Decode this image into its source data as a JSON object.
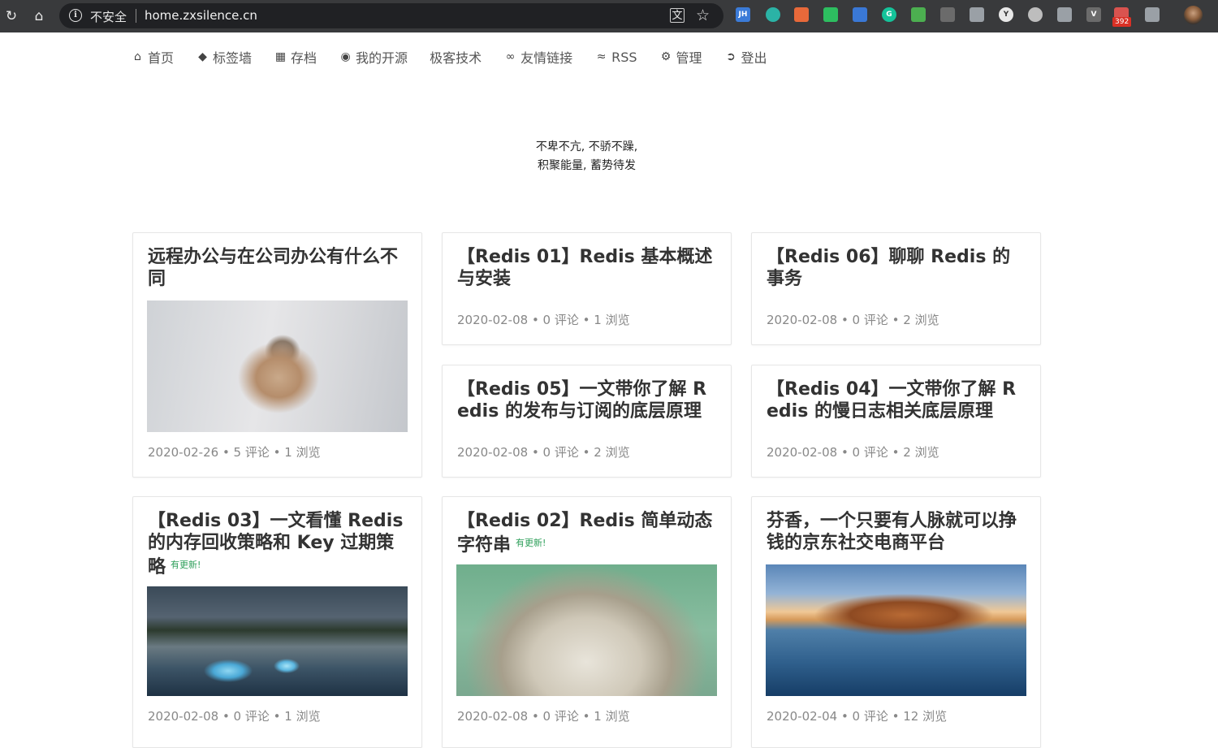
{
  "browser": {
    "insecure_label": "不安全",
    "url": "home.zxsilence.cn",
    "extensions": [
      {
        "name": "jh-extension-icon",
        "label": "JH",
        "color": "#3b7bd8"
      },
      {
        "name": "teal-circle-extension-icon",
        "label": "",
        "color": "#2bb3a6"
      },
      {
        "name": "orange-extension-icon",
        "label": "",
        "color": "#e8693a"
      },
      {
        "name": "evernote-extension-icon",
        "label": "",
        "color": "#2dbe60"
      },
      {
        "name": "blue-globe-extension-icon",
        "label": "",
        "color": "#3a78d6"
      },
      {
        "name": "grammarly-extension-icon",
        "label": "G",
        "color": "#15c39a"
      },
      {
        "name": "green-grid-extension-icon",
        "label": "",
        "color": "#4caf50"
      },
      {
        "name": "octocat-extension-icon",
        "label": "",
        "color": "#6b6b6b"
      },
      {
        "name": "checkmark-extension-icon",
        "label": "",
        "color": "#9aa0a6"
      },
      {
        "name": "y-extension-icon",
        "label": "Y",
        "color": "#e8e8e8"
      },
      {
        "name": "circle-extension-icon",
        "label": "",
        "color": "#bdbdbd"
      },
      {
        "name": "shield-extension-icon",
        "label": "",
        "color": "#9aa0a6"
      },
      {
        "name": "v-extension-icon",
        "label": "V",
        "color": "#6b6b6b"
      },
      {
        "name": "mail-extension-icon",
        "label": "",
        "color": "#d9534f"
      },
      {
        "name": "pin-extension-icon",
        "label": "",
        "color": "#9aa0a6"
      }
    ],
    "mail_badge": "392"
  },
  "nav": [
    {
      "label": "首页",
      "icon": "home-icon"
    },
    {
      "label": "标签墙",
      "icon": "tag-icon"
    },
    {
      "label": "存档",
      "icon": "archive-icon"
    },
    {
      "label": "我的开源",
      "icon": "github-icon"
    },
    {
      "label": "极客技术",
      "icon": ""
    },
    {
      "label": "友情链接",
      "icon": "link-icon"
    },
    {
      "label": "RSS",
      "icon": "rss-icon"
    },
    {
      "label": "管理",
      "icon": "gear-icon"
    },
    {
      "label": "登出",
      "icon": "signout-icon"
    }
  ],
  "motto": {
    "line1": "不卑不亢, 不骄不躁,",
    "line2": "积聚能量, 蓄势待发"
  },
  "update_badge": "有更新!",
  "posts": [
    {
      "title": "远程办公与在公司办公有什么不同",
      "meta": "2020-02-26 • 5 评论 • 1 浏览",
      "image": "bird-on-frosted-branch"
    },
    {
      "title": "【Redis 01】Redis 基本概述与安装",
      "meta": "2020-02-08 • 0 评论 • 1 浏览"
    },
    {
      "title": "【Redis 06】聊聊 Redis 的事务",
      "meta": "2020-02-08 • 0 评论 • 2 浏览"
    },
    {
      "title": "【Redis 05】一文带你了解 Redis 的发布与订阅的底层原理",
      "meta": "2020-02-08 • 0 评论 • 2 浏览"
    },
    {
      "title": "【Redis 04】一文带你了解 Redis 的慢日志相关底层原理",
      "meta": "2020-02-08 • 0 评论 • 2 浏览"
    },
    {
      "title": "【Redis 03】一文看懂 Redis 的内存回收策略和 Key 过期策略",
      "meta": "2020-02-08 • 0 评论 • 1 浏览",
      "image": "misty-lake-with-ice"
    },
    {
      "title": "【Redis 02】Redis 简单动态字符串",
      "meta": "2020-02-08 • 0 评论 • 1 浏览",
      "image": "frayed-rope-mop"
    },
    {
      "title": "芬香，一个只要有人脉就可以挣钱的京东社交电商平台",
      "meta": "2020-02-04 • 0 评论 • 12 浏览",
      "image": "frozen-lake-with-island"
    }
  ]
}
